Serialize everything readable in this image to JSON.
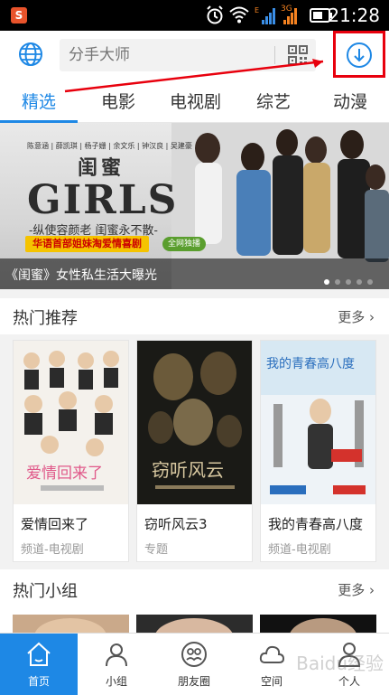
{
  "status_bar": {
    "app_badge": "S",
    "network": "3G",
    "time": "21:28"
  },
  "search": {
    "placeholder": "分手大师"
  },
  "tabs": [
    {
      "label": "精选",
      "active": true
    },
    {
      "label": "电影",
      "active": false
    },
    {
      "label": "电视剧",
      "active": false
    },
    {
      "label": "综艺",
      "active": false
    },
    {
      "label": "动漫",
      "active": false
    }
  ],
  "banner": {
    "cast": "陈意涵 | 薛凯琪 | 杨子姗 | 余文乐 | 钟汉良 | 吴建豪",
    "title_cn": "闺蜜",
    "title_en": "GIRLS",
    "tagline": "-纵使容颜老  闺蜜永不散-",
    "promo": "华语首部姐妹淘爱情喜剧",
    "promo_badge": "全网独播",
    "caption": "《闺蜜》女性私生活大曝光"
  },
  "hot_recommend": {
    "title": "热门推荐",
    "more": "更多",
    "items": [
      {
        "title": "爱情回来了",
        "sub": "频道-电视剧",
        "poster_text": "爱情回来了"
      },
      {
        "title": "窃听风云3",
        "sub": "专题",
        "poster_text": "窃听风云"
      },
      {
        "title": "我的青春高八度",
        "sub": "频道-电视剧",
        "poster_text": "我的青春高八度"
      }
    ]
  },
  "hot_groups": {
    "title": "热门小组",
    "more": "更多"
  },
  "bottom_nav": [
    {
      "label": "首页",
      "active": true
    },
    {
      "label": "小组",
      "active": false
    },
    {
      "label": "朋友圈",
      "active": false
    },
    {
      "label": "空间",
      "active": false
    },
    {
      "label": "个人",
      "active": false
    }
  ],
  "watermark": "Baidu经验",
  "colors": {
    "accent": "#1e88e5",
    "annotation": "#e8000d"
  }
}
